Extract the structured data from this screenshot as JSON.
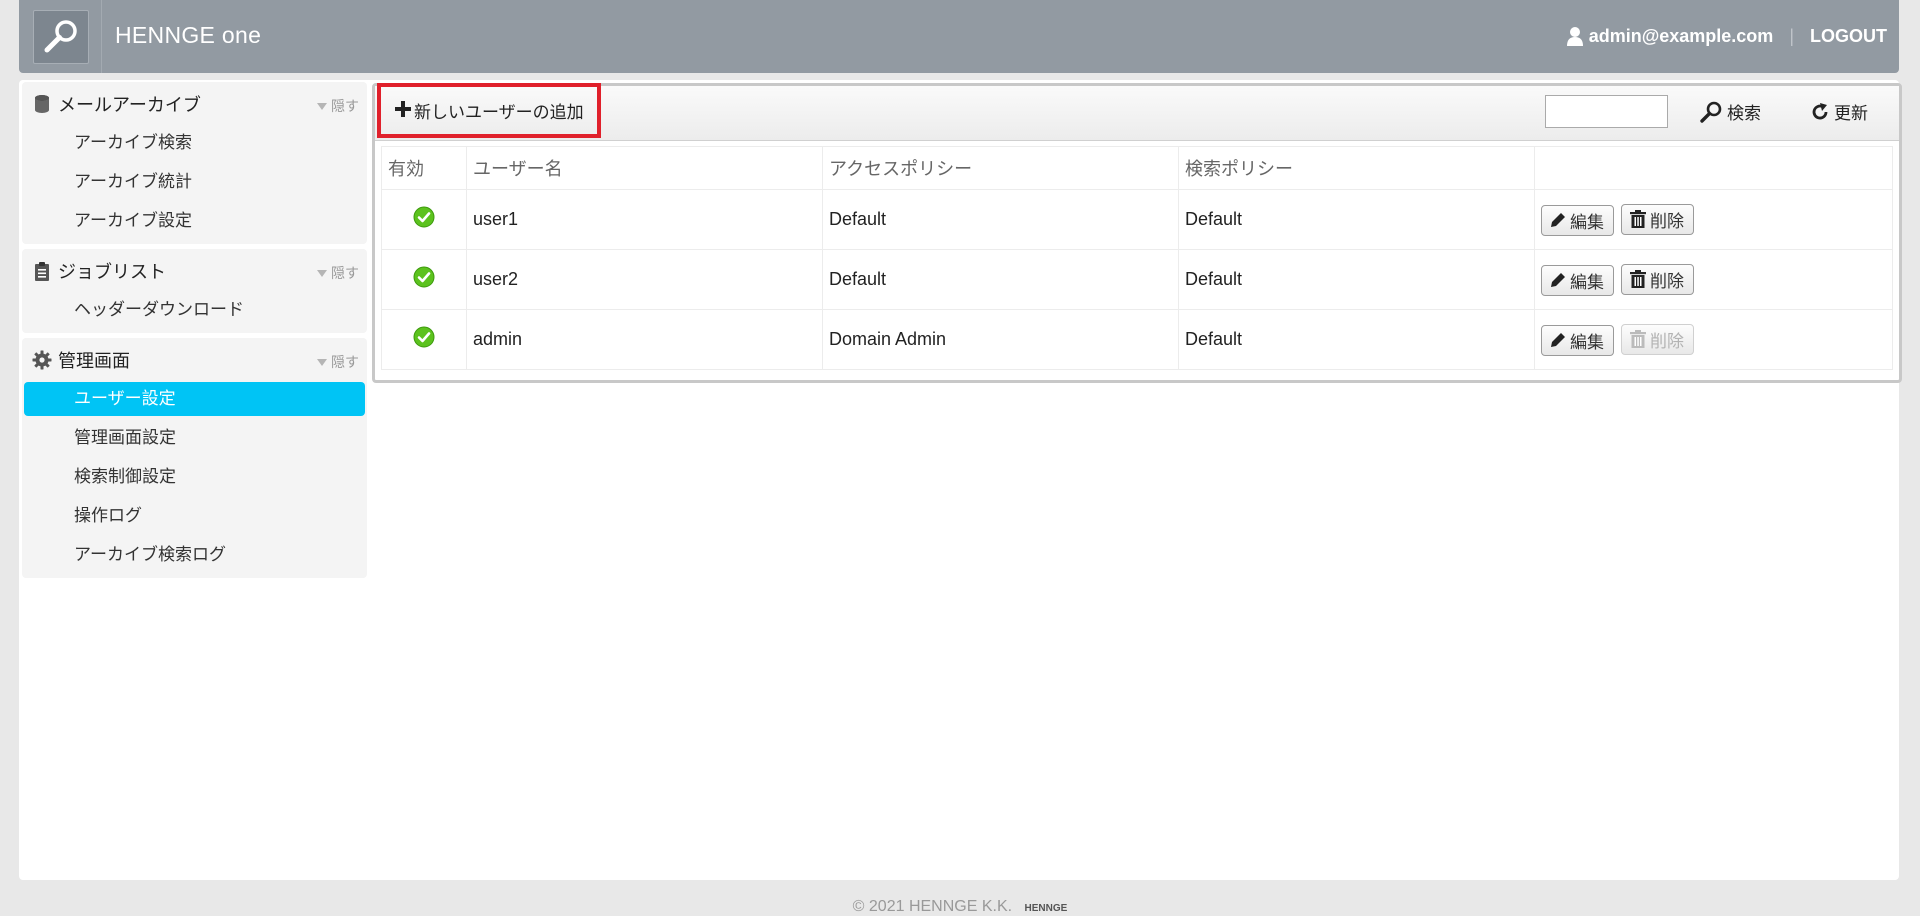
{
  "header": {
    "brand_main": "HENNGE",
    "brand_suffix": "one",
    "user_email": "admin@example.com",
    "separator": "|",
    "logout_label": "LOGOUT"
  },
  "sidebar": {
    "hide_label": "隠す",
    "sections": [
      {
        "title": "メールアーカイブ",
        "icon": "database-icon",
        "items": [
          {
            "label": "アーカイブ検索"
          },
          {
            "label": "アーカイブ統計"
          },
          {
            "label": "アーカイブ設定"
          }
        ]
      },
      {
        "title": "ジョブリスト",
        "icon": "clipboard-icon",
        "items": [
          {
            "label": "ヘッダーダウンロード"
          }
        ]
      },
      {
        "title": "管理画面",
        "icon": "gear-icon",
        "items": [
          {
            "label": "ユーザー設定",
            "active": true
          },
          {
            "label": "管理画面設定"
          },
          {
            "label": "検索制御設定"
          },
          {
            "label": "操作ログ"
          },
          {
            "label": "アーカイブ検索ログ"
          }
        ]
      }
    ]
  },
  "toolbar": {
    "add_user_label": "新しいユーザーの追加",
    "search_value": "",
    "search_label": "検索",
    "refresh_label": "更新"
  },
  "table": {
    "columns": [
      "有効",
      "ユーザー名",
      "アクセスポリシー",
      "検索ポリシー",
      ""
    ],
    "edit_label": "編集",
    "delete_label": "削除",
    "rows": [
      {
        "enabled": true,
        "username": "user1",
        "access_policy": "Default",
        "search_policy": "Default",
        "delete_enabled": true
      },
      {
        "enabled": true,
        "username": "user2",
        "access_policy": "Default",
        "search_policy": "Default",
        "delete_enabled": true
      },
      {
        "enabled": true,
        "username": "admin",
        "access_policy": "Domain Admin",
        "search_policy": "Default",
        "delete_enabled": false
      }
    ]
  },
  "footer": {
    "copyright": "© 2021 HENNGE K.K.",
    "logo_text": "HENNGE"
  },
  "colors": {
    "header_bg": "#929aa2",
    "active_nav": "#00c4f5",
    "highlight_border": "#e0202b",
    "status_ok": "#5cc21e"
  }
}
